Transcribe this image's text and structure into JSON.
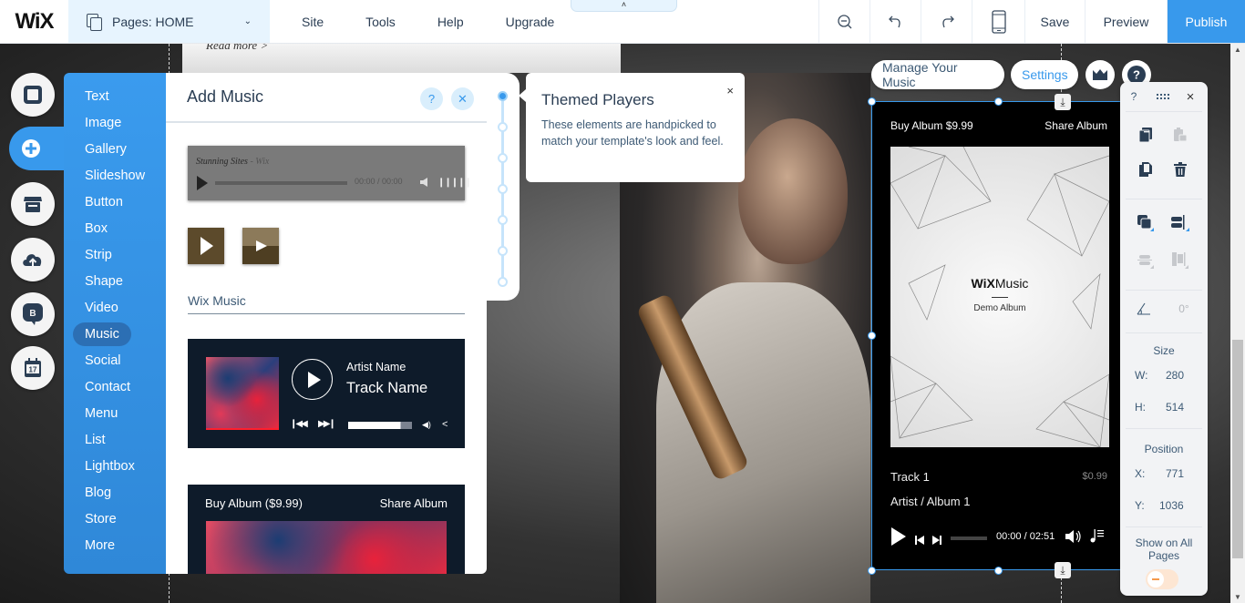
{
  "topbar": {
    "logo": "WiX",
    "pages_label": "Pages: HOME",
    "menu": [
      "Site",
      "Tools",
      "Help",
      "Upgrade"
    ],
    "collapse_icon": "chevron-up-icon",
    "tools": [
      "zoom-out-icon",
      "undo-icon",
      "redo-icon",
      "mobile-view-icon"
    ],
    "save_label": "Save",
    "preview_label": "Preview",
    "publish_label": "Publish"
  },
  "canvas": {
    "read_more": "Read more >"
  },
  "left_bar": {
    "buttons": [
      "background-icon",
      "add-icon",
      "app-market-icon",
      "upload-icon",
      "blog-icon",
      "bookings-icon"
    ],
    "active": "add-icon"
  },
  "add_menu": {
    "items": [
      "Text",
      "Image",
      "Gallery",
      "Slideshow",
      "Button",
      "Box",
      "Strip",
      "Shape",
      "Video",
      "Music",
      "Social",
      "Contact",
      "Menu",
      "List",
      "Lightbox",
      "Blog",
      "Store",
      "More"
    ],
    "selected": "Music"
  },
  "add_panel": {
    "title": "Add Music",
    "help_label": "?",
    "close_label": "✕",
    "classic_player": {
      "title": "Stunning Sites",
      "separator": " - ",
      "artist": "Wix",
      "time": "00:00 / 00:00"
    },
    "section_title": "Wix Music",
    "player1": {
      "artist": "Artist Name",
      "track": "Track Name",
      "progress": 0.82
    },
    "player2": {
      "buy": "Buy Album ($9.99)",
      "share": "Share Album"
    }
  },
  "stepper": {
    "steps": 7,
    "active_index": 0
  },
  "tooltip": {
    "title": "Themed Players",
    "description": "These elements are handpicked to match your template's look and feel.",
    "close_label": "×"
  },
  "element_actions": {
    "manage_label": "Manage Your Music",
    "settings_label": "Settings",
    "upgrade_icon": "crown-icon",
    "help_icon": "help-icon"
  },
  "selected_player": {
    "buy": "Buy Album $9.99",
    "share": "Share Album",
    "brand_bold": "WiX",
    "brand_light": "Music",
    "album": "Demo Album",
    "track": "Track 1",
    "price": "$0.99",
    "artist_album": "Artist / Album 1",
    "time": "00:00 / 02:51"
  },
  "right_toolbar": {
    "help_label": "?",
    "close_label": "×",
    "icons": [
      "copy-icon",
      "paste-icon",
      "duplicate-icon",
      "delete-icon",
      "arrange-icon",
      "align-icon",
      "distribute-icon",
      "match-size-icon",
      "rotate-icon"
    ],
    "rotation": "0°",
    "size_label": "Size",
    "w_label": "W:",
    "w": "280",
    "h_label": "H:",
    "h": "514",
    "position_label": "Position",
    "x_label": "X:",
    "x": "771",
    "y_label": "Y:",
    "y": "1036",
    "show_all_label": "Show on All Pages",
    "show_all_on": false
  },
  "colors": {
    "accent": "#3899ec",
    "topbar_highlight": "#e7f4fe",
    "text": "#2b3e54"
  }
}
